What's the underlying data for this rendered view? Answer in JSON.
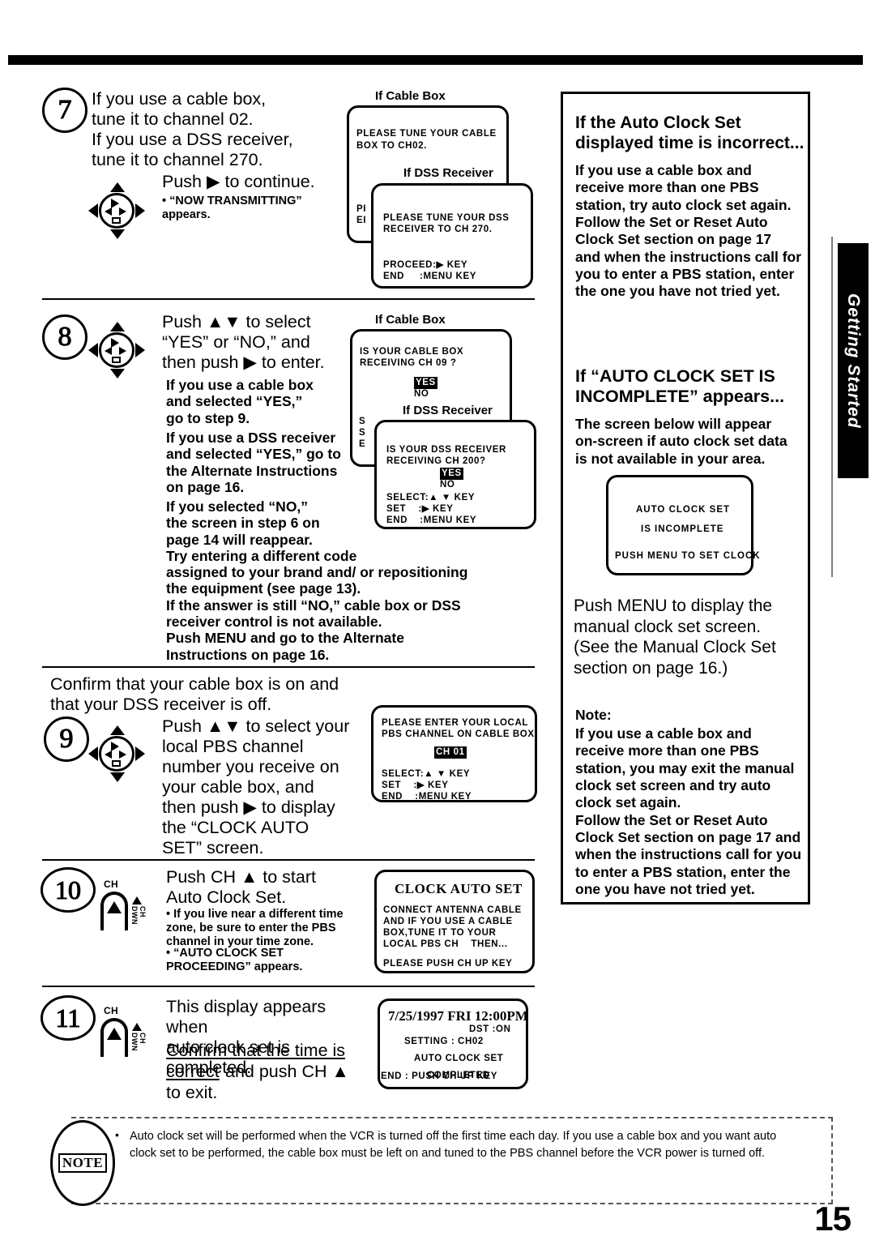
{
  "page": {
    "number": "15",
    "side_tab_label": "Getting Started"
  },
  "steps": [
    {
      "id": "step-7",
      "number": "7",
      "heading": "If you use a cable box,\ntune it to channel 02.\nIf you use a DSS receiver,\ntune it to channel 270.",
      "instruction": "Push ▶ to continue.",
      "bullets": [
        "• “NOW TRANSMITTING”\n   appears."
      ],
      "icon": "dpad-icon"
    },
    {
      "id": "step-8",
      "number": "8",
      "instruction": "Push ▲▼ to select\n“YES” or “NO,” and\nthen push ▶ to enter.",
      "paragraphs": [
        "If you use a cable box\nand selected “YES,”\ngo to step 9.",
        "If you use a DSS receiver\nand selected “YES,” go to\nthe Alternate Instructions\non page 16.",
        "If you selected “NO,”\nthe screen in step 6 on\npage 14 will reappear.\nTry entering a different code\nassigned to your brand and/ or repositioning\nthe equipment (see page 13).\nIf the answer is still “NO,” cable box or DSS\nreceiver control is not available.\nPush MENU and go to the Alternate\nInstructions on page 16."
      ],
      "icon": "dpad-icon"
    },
    {
      "id": "step-9",
      "number": "9",
      "preamble": "Confirm that your cable box is on and\nthat your DSS receiver is off.",
      "instruction": "Push ▲▼ to select your\nlocal PBS channel\nnumber you receive on\nyour cable box, and\nthen push ▶ to display\nthe “CLOCK AUTO\nSET” screen.",
      "icon": "dpad-icon"
    },
    {
      "id": "step-10",
      "number": "10",
      "instruction": "Push CH ▲ to start\nAuto Clock Set.",
      "bullets": [
        "• If you live near a different time\n  zone, be sure to enter the PBS\n  channel in your time zone.",
        "• “AUTO CLOCK SET\n  PROCEEDING” appears."
      ],
      "icon": "ch-up-button-icon"
    },
    {
      "id": "step-11",
      "number": "11",
      "instruction_plain_1": "This display appears when\nauto clock set is completed.",
      "instruction_underline_1": "Confirm that the time is",
      "instruction_underline_2": "correct",
      "instruction_plain_2": " and push CH ▲",
      "instruction_plain_3": "to exit.",
      "icon": "ch-up-button-icon"
    }
  ],
  "screens": {
    "s7_cable": {
      "caption": "If Cable Box",
      "lines": [
        "PLEASE TUNE YOUR CABLE",
        "BOX TO CH02."
      ],
      "footer": [
        "PROCEED:▶ KEY",
        "END     :MENU KEY"
      ],
      "footer_clipped": [
        "PI",
        "EI"
      ]
    },
    "s7_dss": {
      "caption": "If DSS Receiver",
      "lines": [
        "PLEASE TUNE YOUR DSS",
        "RECEIVER TO CH 270."
      ],
      "footer": [
        "PROCEED:▶ KEY",
        "END     :MENU KEY"
      ]
    },
    "s8_cable": {
      "caption": "If Cable Box",
      "lines": [
        "IS YOUR CABLE BOX",
        "RECEIVING CH 09 ?"
      ],
      "option_selected": "YES",
      "option_other": "NO",
      "footer_clipped": [
        "S",
        "S",
        "E"
      ]
    },
    "s8_dss": {
      "caption": "If DSS Receiver",
      "lines": [
        "IS YOUR DSS RECEIVER",
        "RECEIVING CH 200?"
      ],
      "option_selected": "YES",
      "option_other": "NO",
      "footer": [
        "SELECT:▲ ▼ KEY",
        "SET    :▶ KEY",
        "END    :MENU KEY"
      ]
    },
    "s9_pbs": {
      "lines": [
        "PLEASE ENTER YOUR LOCAL",
        "PBS CHANNEL ON CABLE BOX"
      ],
      "field_value": "CH 01",
      "footer": [
        "SELECT:▲ ▼ KEY",
        "SET    :▶ KEY",
        "END    :MENU KEY"
      ]
    },
    "s10_clock": {
      "title": "CLOCK AUTO SET",
      "lines": [
        "CONNECT ANTENNA CABLE",
        "AND IF YOU USE A CABLE",
        "BOX,TUNE IT TO YOUR",
        "LOCAL PBS CH    THEN..."
      ],
      "footer": [
        "PLEASE PUSH CH UP KEY"
      ]
    },
    "s11_done": {
      "datetime": "7/25/1997 FRI 12:00PM",
      "dst": "DST :ON",
      "setting": "SETTING : CH02",
      "status_1": "AUTO CLOCK SET",
      "status_2": "COMPLETED",
      "footer": "END  :  PUSH CH UP KEY"
    },
    "sr_incomplete": {
      "line_1": "AUTO CLOCK SET",
      "line_2": "IS INCOMPLETE",
      "line_3": "PUSH MENU TO SET CLOCK"
    }
  },
  "right_column": {
    "panel_1": {
      "heading": "If the Auto Clock Set\ndisplayed time is incorrect...",
      "body": "If you use a cable box and\nreceive more than one PBS\nstation, try auto clock set again.\nFollow the Set or Reset Auto\nClock Set section on page 17\nand when the instructions call for\nyou to enter a PBS station, enter\nthe one you have not tried yet."
    },
    "panel_2": {
      "heading": "If “AUTO CLOCK SET IS\nINCOMPLETE” appears...",
      "body": "The screen below will appear\non-screen if auto clock set data\nis not available in your area."
    },
    "panel_3": {
      "body": "Push MENU to display the\nmanual clock set screen.\n(See the Manual Clock Set\nsection on page 16.)",
      "note_label": "Note:",
      "note_body": "If you use a cable box and\nreceive more than one PBS\nstation, you may exit the manual\nclock set screen and try auto\nclock set again.\nFollow the Set or Reset Auto\nClock Set section on page 17 and\nwhen the instructions call for you\nto enter a PBS station, enter the\none you have not tried yet."
    }
  },
  "note_block": {
    "label": "NOTE",
    "bullet": "•",
    "text": "Auto clock set will be performed when the VCR is turned off the first time each day. If you use a cable box and you want auto clock set to be performed, the cable box must be left on and tuned to the PBS channel before the VCR power is turned off."
  }
}
